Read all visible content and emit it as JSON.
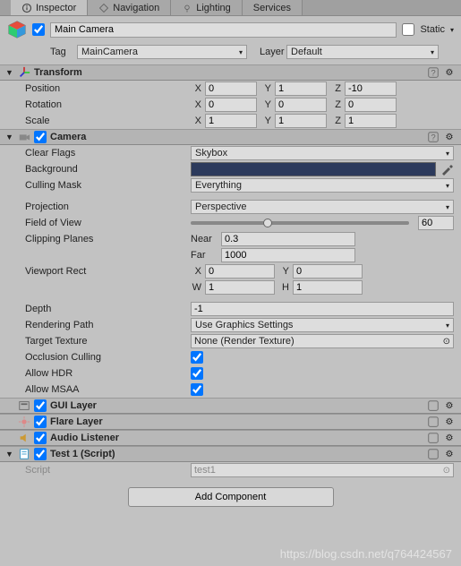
{
  "tabs": {
    "inspector": "Inspector",
    "navigation": "Navigation",
    "lighting": "Lighting",
    "services": "Services"
  },
  "header": {
    "name": "Main Camera",
    "static_label": "Static",
    "static_checked": false,
    "active_checked": true,
    "tag_label": "Tag",
    "tag_value": "MainCamera",
    "layer_label": "Layer",
    "layer_value": "Default"
  },
  "transform": {
    "title": "Transform",
    "position": {
      "label": "Position",
      "x": "0",
      "y": "1",
      "z": "-10"
    },
    "rotation": {
      "label": "Rotation",
      "x": "0",
      "y": "0",
      "z": "0"
    },
    "scale": {
      "label": "Scale",
      "x": "1",
      "y": "1",
      "z": "1"
    }
  },
  "camera": {
    "title": "Camera",
    "enabled": true,
    "clear_flags": {
      "label": "Clear Flags",
      "value": "Skybox"
    },
    "background": {
      "label": "Background",
      "color": "#2c3a5c"
    },
    "culling_mask": {
      "label": "Culling Mask",
      "value": "Everything"
    },
    "projection": {
      "label": "Projection",
      "value": "Perspective"
    },
    "fov": {
      "label": "Field of View",
      "value": "60",
      "percent": 33
    },
    "clipping": {
      "label": "Clipping Planes",
      "near_label": "Near",
      "near": "0.3",
      "far_label": "Far",
      "far": "1000"
    },
    "viewport": {
      "label": "Viewport Rect",
      "x": "0",
      "y": "0",
      "w": "1",
      "h": "1"
    },
    "depth": {
      "label": "Depth",
      "value": "-1"
    },
    "rendering_path": {
      "label": "Rendering Path",
      "value": "Use Graphics Settings"
    },
    "target_texture": {
      "label": "Target Texture",
      "value": "None (Render Texture)"
    },
    "occlusion": {
      "label": "Occlusion Culling",
      "checked": true
    },
    "hdr": {
      "label": "Allow HDR",
      "checked": true
    },
    "msaa": {
      "label": "Allow MSAA",
      "checked": true
    }
  },
  "gui_layer": {
    "title": "GUI Layer",
    "enabled": true
  },
  "flare_layer": {
    "title": "Flare Layer",
    "enabled": true
  },
  "audio_listener": {
    "title": "Audio Listener",
    "enabled": true
  },
  "test_script": {
    "title": "Test 1 (Script)",
    "enabled": true,
    "script_label": "Script",
    "script_value": "test1"
  },
  "add_component": "Add Component",
  "watermark": "https://blog.csdn.net/q764424567"
}
